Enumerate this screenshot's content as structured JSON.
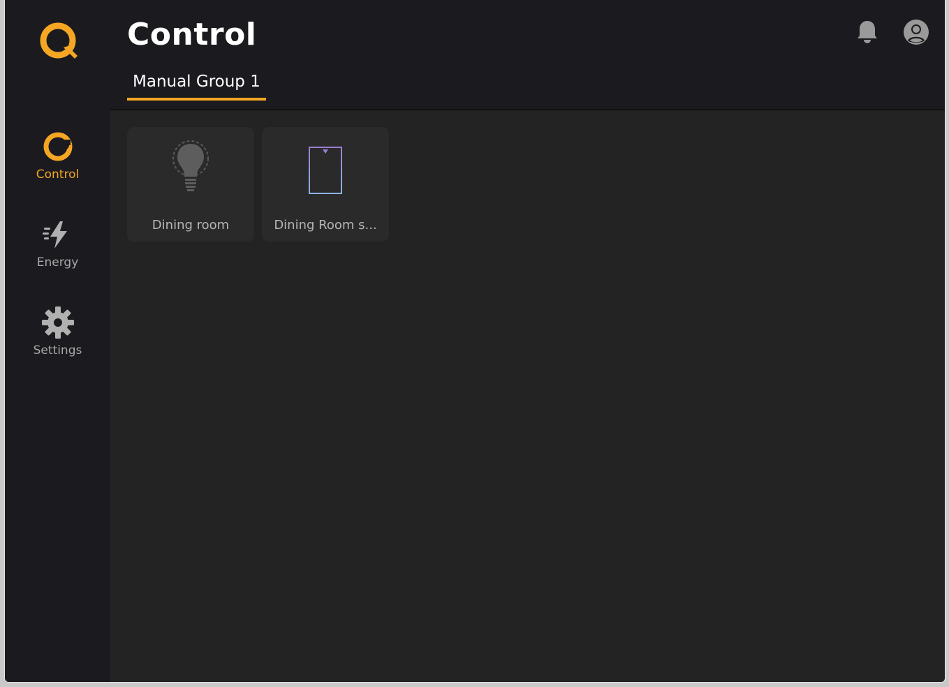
{
  "app": {
    "logo_icon": "q-logo-icon",
    "accent_color": "#f5a623"
  },
  "sidebar": {
    "items": [
      {
        "label": "Control",
        "icon": "control-icon",
        "active": true
      },
      {
        "label": "Energy",
        "icon": "energy-bolt-icon",
        "active": false
      },
      {
        "label": "Settings",
        "icon": "gear-icon",
        "active": false
      }
    ]
  },
  "header": {
    "title": "Control",
    "tabs": [
      {
        "label": "Manual Group 1",
        "active": true
      }
    ],
    "notification_icon": "bell-icon",
    "account_icon": "user-avatar-icon"
  },
  "devices": [
    {
      "label": "Dining room",
      "icon": "lightbulb-icon"
    },
    {
      "label": "Dining Room s...",
      "icon": "shade-icon"
    }
  ]
}
